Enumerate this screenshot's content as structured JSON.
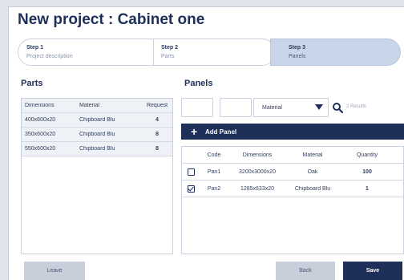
{
  "title": "New project : Cabinet one",
  "steps": [
    {
      "number": "Step 1",
      "label": "Project description"
    },
    {
      "number": "Step 2",
      "label": "Parts"
    },
    {
      "number": "Step 3",
      "label": "Panels"
    }
  ],
  "parts": {
    "heading": "Parts",
    "columns": [
      "Dimensions",
      "Material",
      "Request"
    ],
    "rows": [
      {
        "dimensions": "400x600x20",
        "material": "Chipboard Blu",
        "request": "4"
      },
      {
        "dimensions": "350x600x20",
        "material": "Chipboard Blu",
        "request": "8"
      },
      {
        "dimensions": "550x600x20",
        "material": "Chipboard Blu",
        "request": "8"
      }
    ]
  },
  "panels": {
    "heading": "Panels",
    "filter_dropdown": "Material",
    "results": "2 Results",
    "add_label": "Add Panel",
    "columns": [
      "Code",
      "Dimensions",
      "Material",
      "Quantity"
    ],
    "rows": [
      {
        "checked": false,
        "code": "Pan1",
        "dimensions": "3200x3000x20",
        "material": "Oak",
        "quantity": "100"
      },
      {
        "checked": true,
        "code": "Pan2",
        "dimensions": "1285x633x20",
        "material": "Chipboard Blu",
        "quantity": "1"
      }
    ]
  },
  "buttons": {
    "leave": "Leave",
    "back": "Back",
    "save": "Save"
  }
}
